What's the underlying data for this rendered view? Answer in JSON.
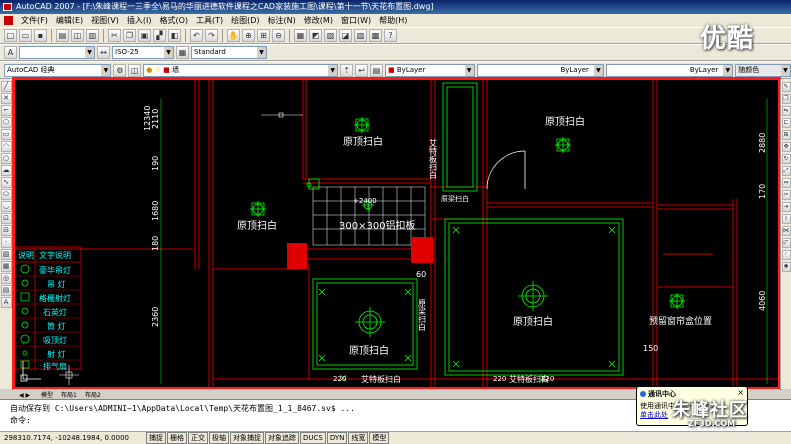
{
  "window": {
    "title": "AutoCAD 2007 - [F:\\朱峰课程一三季全\\易马的华丽进德软件课程之CAD家装施工图\\课程\\第十一节\\天花布置图.dwg]"
  },
  "menu": [
    "文件(F)",
    "编辑(E)",
    "视图(V)",
    "插入(I)",
    "格式(O)",
    "工具(T)",
    "绘图(D)",
    "标注(N)",
    "修改(M)",
    "窗口(W)",
    "帮助(H)"
  ],
  "toolbar2": {
    "dim_style": "ISO-25",
    "text_style": "Standard"
  },
  "toolbar3": {
    "workspace": "AutoCAD 经典",
    "layer": "墙",
    "color": "ByLayer",
    "linetype": "ByLayer",
    "lineweight": "ByLayer",
    "plotstyle": "随颜色"
  },
  "drawing": {
    "dims_left": [
      "12340",
      "2110",
      "190",
      "1680",
      "180",
      "2360"
    ],
    "dims_right": [
      "2880",
      "170",
      "4060"
    ],
    "dim_2400": "+2400",
    "dim_60": "60",
    "dim_150": "150",
    "dim_220a": "220",
    "dim_220b": "220",
    "dim_220c": "220",
    "rooms": {
      "r1": "原顶扫白",
      "r2": "原顶扫白",
      "r3": "原顶扫白",
      "r4": "原顶扫白",
      "r5": "原顶扫白",
      "r6": "原顶扫白",
      "aluminum": "300×300铝扣板",
      "curtain": "预留窗帘盒位置",
      "vertical1": "艾特板扫白",
      "vertical2": "原梁扫白",
      "vertical3": "原梁扫白",
      "bottom1": "艾特板扫白",
      "bottom2": "艾特板扫白"
    },
    "legend": {
      "headers": [
        "说明",
        "文字说明"
      ],
      "rows": [
        "豪华吊灯",
        "吊 灯",
        "格栅射灯",
        "石英灯",
        "筒 灯",
        "吸顶灯",
        "射 灯",
        "排气扇"
      ]
    }
  },
  "tabs": [
    "模型",
    "布局1",
    "布局2"
  ],
  "command": {
    "line1": "自动保存到 C:\\Users\\ADMINI~1\\AppData\\Local\\Temp\\天花布置图_1_1_8467.sv$ ...",
    "line2": "命令:"
  },
  "status": {
    "coords": "298310.7174, -10248.1984, 0.0000",
    "buttons": [
      "捕捉",
      "栅格",
      "正交",
      "极轴",
      "对象捕捉",
      "对象追踪",
      "DUCS",
      "DYN",
      "线宽",
      "模型"
    ]
  },
  "balloon": {
    "title": "通讯中心",
    "body": "使用通讯中心获得最新的",
    "link": "单击此处"
  },
  "watermark_top": "优酷",
  "watermark_bottom": "朱峰社区",
  "watermark_bottom_sub": "ZF3D.COM",
  "colors": {
    "frame_red": "#ff1a1a",
    "cad_red": "#cc0000",
    "cad_green": "#00ff00",
    "cad_white": "#ffffff",
    "cad_cyan": "#00ffff"
  }
}
